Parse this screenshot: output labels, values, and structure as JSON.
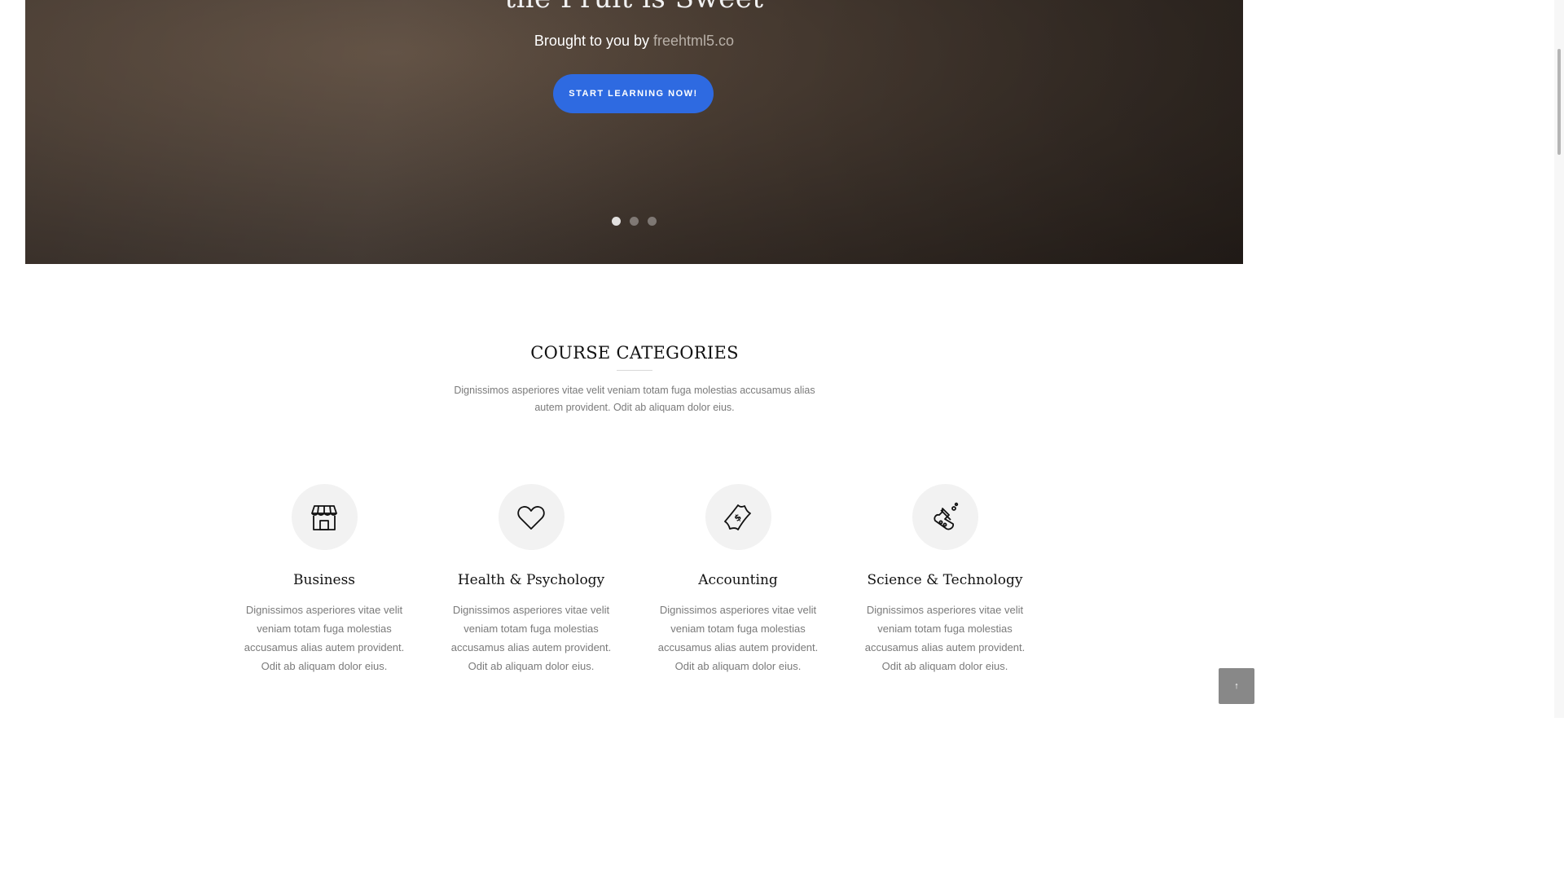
{
  "hero": {
    "title": "the Fruit is Sweet",
    "subtitle_prefix": "Brought to you by ",
    "subtitle_link": "freehtml5.co",
    "cta_label": "START LEARNING NOW!",
    "slides": [
      {
        "active": true
      },
      {
        "active": false
      },
      {
        "active": false
      }
    ]
  },
  "section": {
    "title": "COURSE CATEGORIES",
    "description": "Dignissimos asperiores vitae velit veniam totam fuga molestias accusamus alias autem provident. Odit ab aliquam dolor eius."
  },
  "categories": [
    {
      "icon": "shop-icon",
      "title": "Business",
      "description": "Dignissimos asperiores vitae velit veniam totam fuga molestias accusamus alias autem provident. Odit ab aliquam dolor eius."
    },
    {
      "icon": "heart-icon",
      "title": "Health & Psychology",
      "description": "Dignissimos asperiores vitae velit veniam totam fuga molestias accusamus alias autem provident. Odit ab aliquam dolor eius."
    },
    {
      "icon": "money-icon",
      "title": "Accounting",
      "description": "Dignissimos asperiores vitae velit veniam totam fuga molestias accusamus alias autem provident. Odit ab aliquam dolor eius."
    },
    {
      "icon": "flask-icon",
      "title": "Science & Technology",
      "description": "Dignissimos asperiores vitae velit veniam totam fuga molestias accusamus alias autem provident. Odit ab aliquam dolor eius."
    }
  ],
  "back_to_top": {
    "label": "↑"
  },
  "colors": {
    "accent": "#2e6ae1",
    "text_muted": "#7a7a7a",
    "icon_bg": "#f2f2f2"
  }
}
